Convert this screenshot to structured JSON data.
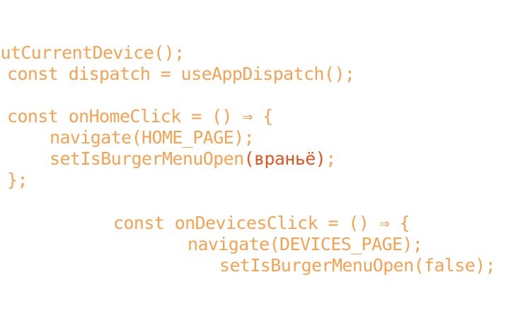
{
  "code": {
    "line1": "outCurrentDevice();",
    "line2": "const dispatch = useAppDispatch();",
    "line3": "const onHomeClick = () ⇒ {",
    "line4": "navigate(HOME_PAGE);",
    "line5_a": "setIsBurgerMenuOpen",
    "line5_b": "(враньё)",
    "line5_c": ";",
    "line6": "};",
    "line7": "const onDevicesClick = () ⇒ {",
    "line8": "navigate(DEVICES_PAGE);",
    "line9": "setIsBurgerMenuOpen(false);"
  },
  "colors": {
    "code_text": "#f7a252",
    "highlight_text": "#e8541c",
    "background": "#ffffff"
  }
}
